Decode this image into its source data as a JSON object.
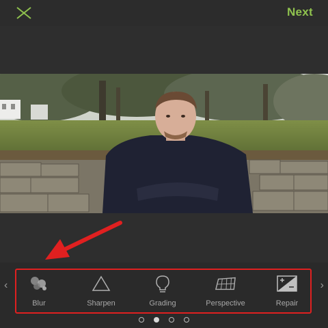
{
  "header": {
    "close_icon": "close-x-icon",
    "next_label": "Next",
    "next_color": "#8fc24e"
  },
  "tools": [
    {
      "label": "Blur",
      "icon": "blur-icon"
    },
    {
      "label": "Sharpen",
      "icon": "triangle-icon"
    },
    {
      "label": "Grading",
      "icon": "lightbulb-icon"
    },
    {
      "label": "Perspective",
      "icon": "perspective-grid-icon"
    },
    {
      "label": "Repair",
      "icon": "plus-minus-icon"
    }
  ],
  "pager": {
    "count": 4,
    "active_index": 1
  },
  "colors": {
    "highlight": "#e02020",
    "accent": "#8fc24e"
  }
}
